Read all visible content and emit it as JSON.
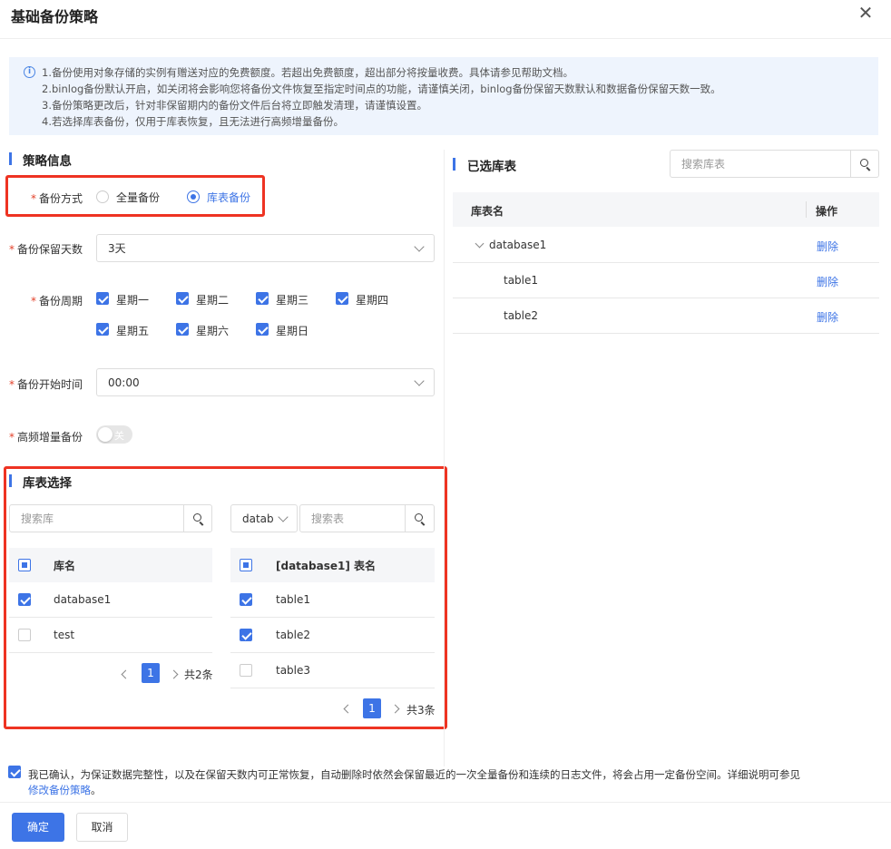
{
  "dialog": {
    "title": "基础备份策略"
  },
  "notice": {
    "lines": [
      "1.备份使用对象存储的实例有赠送对应的免费额度。若超出免费额度，超出部分将按量收费。具体请参见帮助文档。",
      "2.binlog备份默认开启，如关闭将会影响您将备份文件恢复至指定时间点的功能，请谨慎关闭，binlog备份保留天数默认和数据备份保留天数一致。",
      "3.备份策略更改后，针对非保留期内的备份文件后台将立即触发清理，请谨慎设置。",
      "4.若选择库表备份，仅用于库表恢复，且无法进行高频增量备份。"
    ]
  },
  "strategy": {
    "title": "策略信息",
    "method_label": "备份方式",
    "method_options": [
      "全量备份",
      "库表备份"
    ],
    "method_selected": "库表备份",
    "retention_label": "备份保留天数",
    "retention_value": "3天",
    "cycle_label": "备份周期",
    "cycle_days": [
      {
        "label": "星期一",
        "checked": true
      },
      {
        "label": "星期二",
        "checked": true
      },
      {
        "label": "星期三",
        "checked": true
      },
      {
        "label": "星期四",
        "checked": true
      },
      {
        "label": "星期五",
        "checked": true
      },
      {
        "label": "星期六",
        "checked": true
      },
      {
        "label": "星期日",
        "checked": true
      }
    ],
    "start_label": "备份开始时间",
    "start_value": "00:00",
    "hf_label": "高频增量备份",
    "hf_toggle_text": "关",
    "hf_enabled": false
  },
  "selection": {
    "title": "库表选择",
    "db_search_placeholder": "搜索库",
    "db_filter_value": "datab",
    "table_search_placeholder": "搜索表",
    "db_header": "库名",
    "db_rows": [
      {
        "name": "database1",
        "checked": true
      },
      {
        "name": "test",
        "checked": false
      }
    ],
    "db_page": "1",
    "db_total": "共2条",
    "table_header": "[database1] 表名",
    "table_rows": [
      {
        "name": "table1",
        "checked": true
      },
      {
        "name": "table2",
        "checked": true
      },
      {
        "name": "table3",
        "checked": false
      }
    ],
    "table_page": "1",
    "table_total": "共3条"
  },
  "selected": {
    "title": "已选库表",
    "search_placeholder": "搜索库表",
    "col_name": "库表名",
    "col_action": "操作",
    "rows": [
      {
        "name": "database1",
        "action": "删除"
      },
      {
        "name": "table1",
        "action": "删除"
      },
      {
        "name": "table2",
        "action": "删除"
      }
    ]
  },
  "confirm": {
    "text": "我已确认，为保证数据完整性，以及在保留天数内可正常恢复，自动删除时依然会保留最近的一次全量备份和连续的日志文件，将会占用一定备份空间。详细说明可参见",
    "link": "修改备份策略",
    "suffix": "。",
    "checked": true
  },
  "footer": {
    "ok": "确定",
    "cancel": "取消"
  },
  "colors": {
    "accent": "#3d74e6",
    "highlight_border": "#e32222",
    "notice_bg": "#eef4fd"
  }
}
